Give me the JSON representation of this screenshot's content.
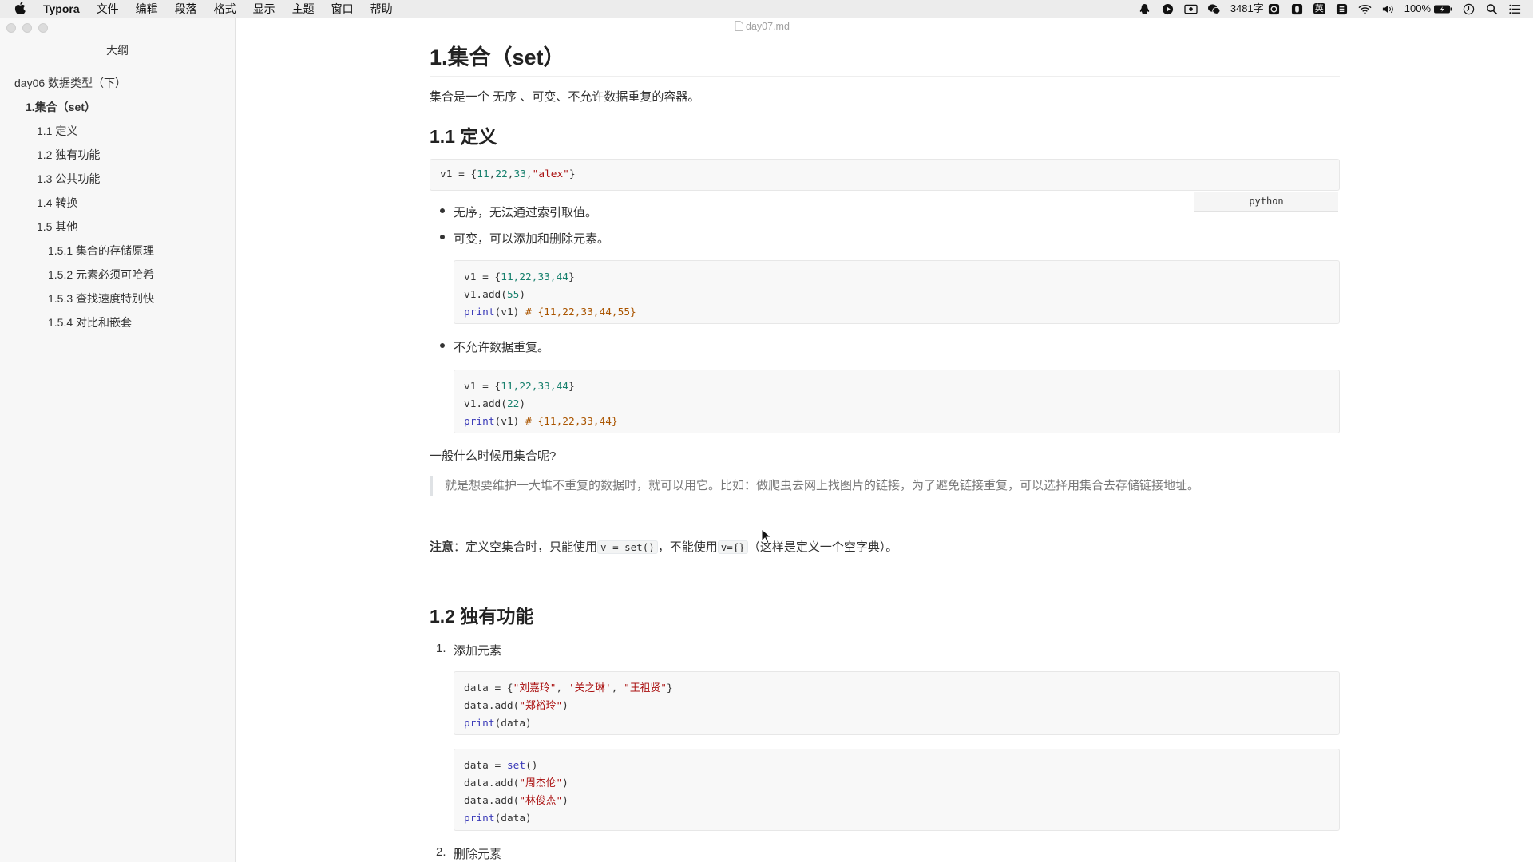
{
  "menubar": {
    "app": "Typora",
    "menus": [
      "文件",
      "编辑",
      "段落",
      "格式",
      "显示",
      "主题",
      "窗口",
      "帮助"
    ],
    "word_count": "3481字",
    "status_text_ying": "英",
    "battery": "100%"
  },
  "window": {
    "doc_title": "day07.md"
  },
  "sidebar": {
    "title": "大纲",
    "items": [
      {
        "label": "day06 数据类型（下）",
        "level": 1
      },
      {
        "label": "1.集合（set）",
        "level": 2
      },
      {
        "label": "1.1 定义",
        "level": 3
      },
      {
        "label": "1.2 独有功能",
        "level": 3
      },
      {
        "label": "1.3 公共功能",
        "level": 3
      },
      {
        "label": "1.4 转换",
        "level": 3
      },
      {
        "label": "1.5 其他",
        "level": 3
      },
      {
        "label": "1.5.1 集合的存储原理",
        "level": 4
      },
      {
        "label": "1.5.2 元素必须可哈希",
        "level": 4
      },
      {
        "label": "1.5.3 查找速度特别快",
        "level": 4
      },
      {
        "label": "1.5.4 对比和嵌套",
        "level": 4
      }
    ]
  },
  "doc": {
    "h1": "1.集合（set）",
    "intro": "集合是一个 无序 、可变、不允许数据重复的容器。",
    "h2_define": "1.1 定义",
    "code1": {
      "a": "v1 = {",
      "n1": "11",
      "c1": ",",
      "n2": "22",
      "c2": ",",
      "n3": "33",
      "c3": ",",
      "s1": "\"alex\"",
      "b": "}"
    },
    "lang_tag": "python",
    "bullet1": "无序，无法通过索引取值。",
    "bullet2": "可变，可以添加和删除元素。",
    "code2": {
      "l1a": "v1 = {",
      "l1n": "11,22,33,44",
      "l1b": "}",
      "l2a": "v1.add(",
      "l2n": "55",
      "l2b": ")",
      "l3k": "print",
      "l3a": "(v1) ",
      "l3c": "# {11,22,33,44,55}"
    },
    "bullet3": "不允许数据重复。",
    "code3": {
      "l1a": "v1 = {",
      "l1n": "11,22,33,44",
      "l1b": "}",
      "l2a": "v1.add(",
      "l2n": "22",
      "l2b": ")",
      "l3k": "print",
      "l3a": "(v1) ",
      "l3c": "# {11,22,33,44}"
    },
    "question": "一般什么时候用集合呢?",
    "quote": "就是想要维护一大堆不重复的数据时，就可以用它。比如：做爬虫去网上找图片的链接，为了避免链接重复，可以选择用集合去存储链接地址。",
    "note_bold": "注意",
    "note_a": "：定义空集合时，只能使用",
    "note_code1": "v = set()",
    "note_b": "，不能使用",
    "note_code2": "v={}",
    "note_c": "（这样是定义一个空字典）。",
    "h2_unique": "1.2 独有功能",
    "ol1_num": "1.",
    "ol1": "添加元素",
    "code4": {
      "l1a": "data = {",
      "l1s1": "\"刘嘉玲\"",
      "l1c1": ", ",
      "l1s2": "'关之琳'",
      "l1c2": ", ",
      "l1s3": "\"王祖贤\"",
      "l1b": "}",
      "l2a": "data.add(",
      "l2s": "\"郑裕玲\"",
      "l2b": ")",
      "l3k": "print",
      "l3a": "(data)"
    },
    "code5": {
      "l1a": "data = ",
      "l1k": "set",
      "l1b": "()",
      "l2a": "data.add(",
      "l2s": "\"周杰伦\"",
      "l2b": ")",
      "l3a": "data.add(",
      "l3s": "\"林俊杰\"",
      "l3b": ")",
      "l4k": "print",
      "l4a": "(data)"
    },
    "ol2_num": "2.",
    "ol2": "删除元素"
  }
}
